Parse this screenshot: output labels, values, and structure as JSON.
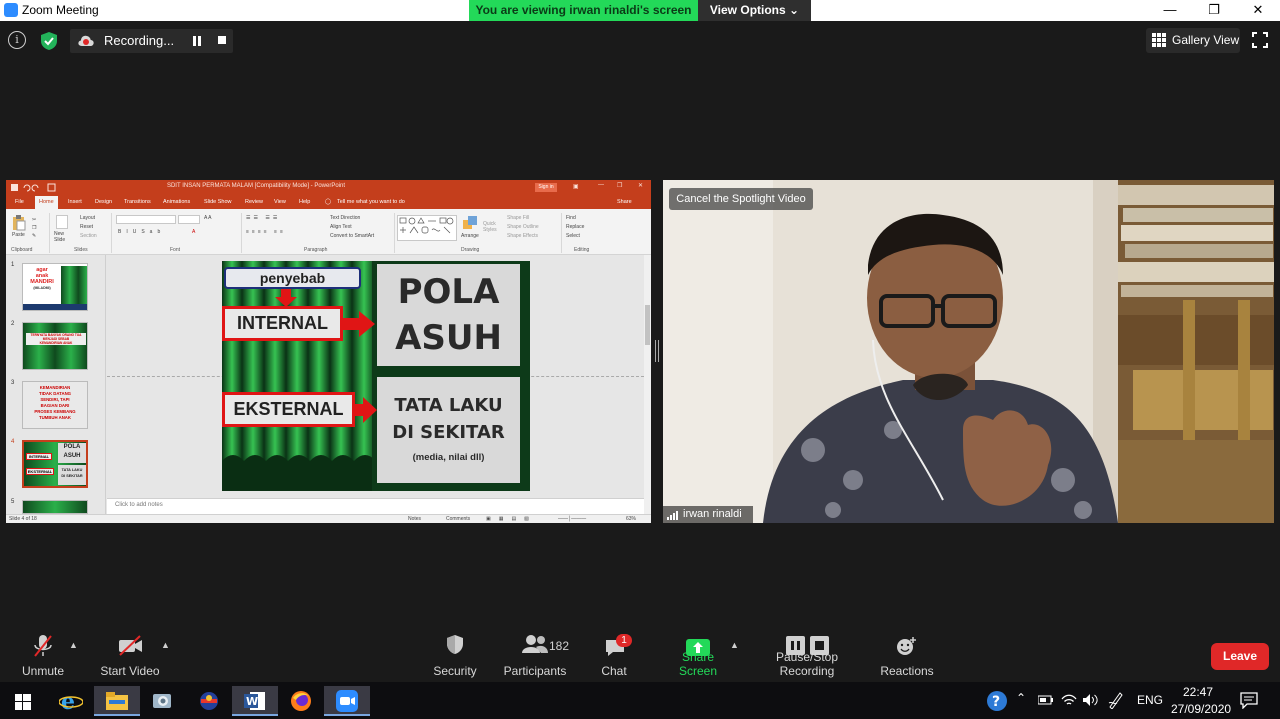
{
  "window": {
    "title": "Zoom Meeting",
    "controls": [
      "minimize-icon",
      "maximize-icon",
      "close-icon"
    ]
  },
  "share_banner": {
    "viewing_text": "You are viewing irwan rinaldi's screen",
    "view_options_label": "View Options"
  },
  "top_bar": {
    "recording_label": "Recording...",
    "gallery_view_label": "Gallery View"
  },
  "shared_screen": {
    "ppt_title": "SDIT INSAN PERMATA MALAM [Compatibility Mode] - PowerPoint",
    "sign_in": "Sign in",
    "share": "Share",
    "tell_me": "Tell me what you want to do",
    "tabs": [
      "File",
      "Home",
      "Insert",
      "Design",
      "Transitions",
      "Animations",
      "Slide Show",
      "Review",
      "View",
      "Help"
    ],
    "ribbon_groups": [
      "Clipboard",
      "Slides",
      "Font",
      "Paragraph",
      "Drawing",
      "Editing"
    ],
    "ribbon_items": {
      "paste": "Paste",
      "new_slide": "New Slide",
      "layout": "Layout",
      "reset": "Reset",
      "section": "Section",
      "text_direction": "Text Direction",
      "align_text": "Align Text",
      "convert_smartart": "Convert to SmartArt",
      "arrange": "Arrange",
      "quick_styles": "Quick Styles",
      "shape_fill": "Shape Fill",
      "shape_outline": "Shape Outline",
      "shape_effects": "Shape Effects",
      "find": "Find",
      "replace": "Replace",
      "select": "Select"
    },
    "thumbnails": [
      {
        "num": "1",
        "lines": [
          "agar",
          "anak",
          "MANDIRI",
          "(MILADMI)"
        ]
      },
      {
        "num": "2",
        "lines": [
          "TERNYATA BANYAK ORANG TUA",
          "MENJADI SEBAB",
          "KEMANDIRIAN ANAK"
        ]
      },
      {
        "num": "3",
        "lines": [
          "KEMANDIRIAN",
          "TIDAK DATANG",
          "SENDIRI, TAPI",
          "BAGIAN DARI",
          "PROSES KEMBANG",
          "TUMBUH ANAK"
        ]
      },
      {
        "num": "4",
        "lines": [
          "POLA",
          "ASUH",
          "INTERNAL",
          "EKSTERNAL",
          "TATA LAKU",
          "DI SEKITAR"
        ]
      },
      {
        "num": "5",
        "lines": []
      }
    ],
    "slide": {
      "penyebab": "penyebab",
      "internal": "INTERNAL",
      "eksternal": "EKSTERNAL",
      "pola_line1": "POLA",
      "pola_line2": "ASUH",
      "tata_line1": "TATA LAKU",
      "tata_line2": "DI SEKITAR",
      "tata_sub": "(media, nilai dll)"
    },
    "notes_placeholder": "Click to add notes",
    "status": {
      "slide_of": "Slide 4 of 18",
      "notes": "Notes",
      "comments": "Comments",
      "zoom": "63%"
    }
  },
  "video": {
    "spotlight_button": "Cancel the Spotlight Video",
    "participant_name": "irwan rinaldi"
  },
  "toolbar": {
    "unmute": "Unmute",
    "start_video": "Start Video",
    "security": "Security",
    "participants": "Participants",
    "participant_count": "182",
    "chat": "Chat",
    "chat_badge": "1",
    "share_screen": "Share Screen",
    "pause_stop_recording": "Pause/Stop Recording",
    "reactions": "Reactions",
    "leave": "Leave"
  },
  "taskbar": {
    "apps": [
      "start-icon",
      "internet-explorer-icon",
      "file-explorer-icon",
      "app-icon",
      "app-icon",
      "word-icon",
      "firefox-icon",
      "zoom-icon"
    ],
    "language": "ENG",
    "time": "22:47",
    "date": "27/09/2020"
  },
  "colors": {
    "zoom_blue": "#2d8cff",
    "share_green": "#23d959",
    "leave_red": "#e02828",
    "ppt_orange": "#c43e1c"
  }
}
